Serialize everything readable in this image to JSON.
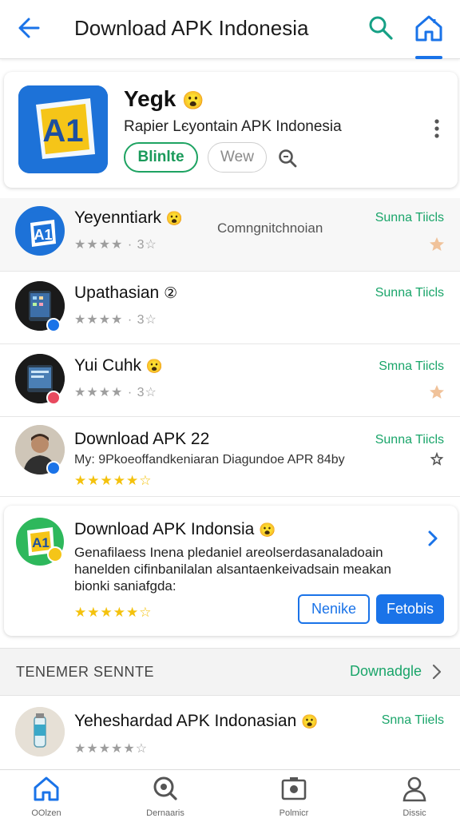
{
  "header": {
    "title": "Download APK Indonesia",
    "back_icon": "arrow-left-icon",
    "search_icon": "search-icon",
    "home_icon": "home-icon",
    "accent": "#1a73e8",
    "search_color": "#16a085"
  },
  "feature": {
    "logo_text": "A1",
    "name": "Yegk",
    "emoji": "😮",
    "subtitle": "Rapier Lєyontain APK Indonesia",
    "primary_button": "Blinlte",
    "secondary_button": "Wew",
    "zoom_icon": "zoom-search-icon",
    "menu_icon": "more-vert-icon"
  },
  "apps": [
    {
      "name": "Yeyenntiark",
      "emoji": "😮",
      "middle": "Comngnitchnoian",
      "rating": "★★★★ · 3☆",
      "action": "Sunna Tiicls",
      "trail_icon": "star-icon"
    },
    {
      "name": "Upathasian",
      "emoji": "②",
      "middle": "",
      "rating": "★★★★ · 3☆",
      "action": "Sunna Tiicls",
      "trail_icon": ""
    },
    {
      "name": "Yui Cuhk",
      "emoji": "😮",
      "middle": "",
      "rating": "★★★★ · 3☆",
      "action": "Smna Tiicls",
      "trail_icon": "star-icon"
    },
    {
      "name": "Download APK 22",
      "emoji": "",
      "middle": "",
      "description": "My: 9Pkoeoffandkeniaran Diagundoe APR 84by",
      "rating": "★★★★★☆",
      "action": "Sunna Tiicls",
      "trail_icon": "pin-icon"
    }
  ],
  "promo": {
    "logo_text": "A1",
    "title": "Download APK Indonsia",
    "emoji": "😮",
    "description": "Genafilaess Inena pledaniel areolserdasanaladoain hanelden cifinbanilalan alsantaenkeivadsain meakan bionki saniafgda:",
    "stars": "★★★★★☆",
    "button1": "Nenike",
    "button2": "Fetobis",
    "chevron_icon": "chevron-right-icon"
  },
  "section": {
    "title": "TENEMER SENNTE",
    "link": "Downadgle",
    "chevron_icon": "chevron-right-icon"
  },
  "last_app": {
    "name": "Yeheshardad APK Indonasian",
    "emoji": "😮",
    "rating": "★★★★★☆",
    "action": "Snna Tiiels"
  },
  "bottom_nav": [
    {
      "label": "OOlzen",
      "icon": "home-icon"
    },
    {
      "label": "Dernaaris",
      "icon": "search-icon"
    },
    {
      "label": "Polmicr",
      "icon": "camera-icon"
    },
    {
      "label": "Dissic",
      "icon": "person-icon"
    }
  ]
}
